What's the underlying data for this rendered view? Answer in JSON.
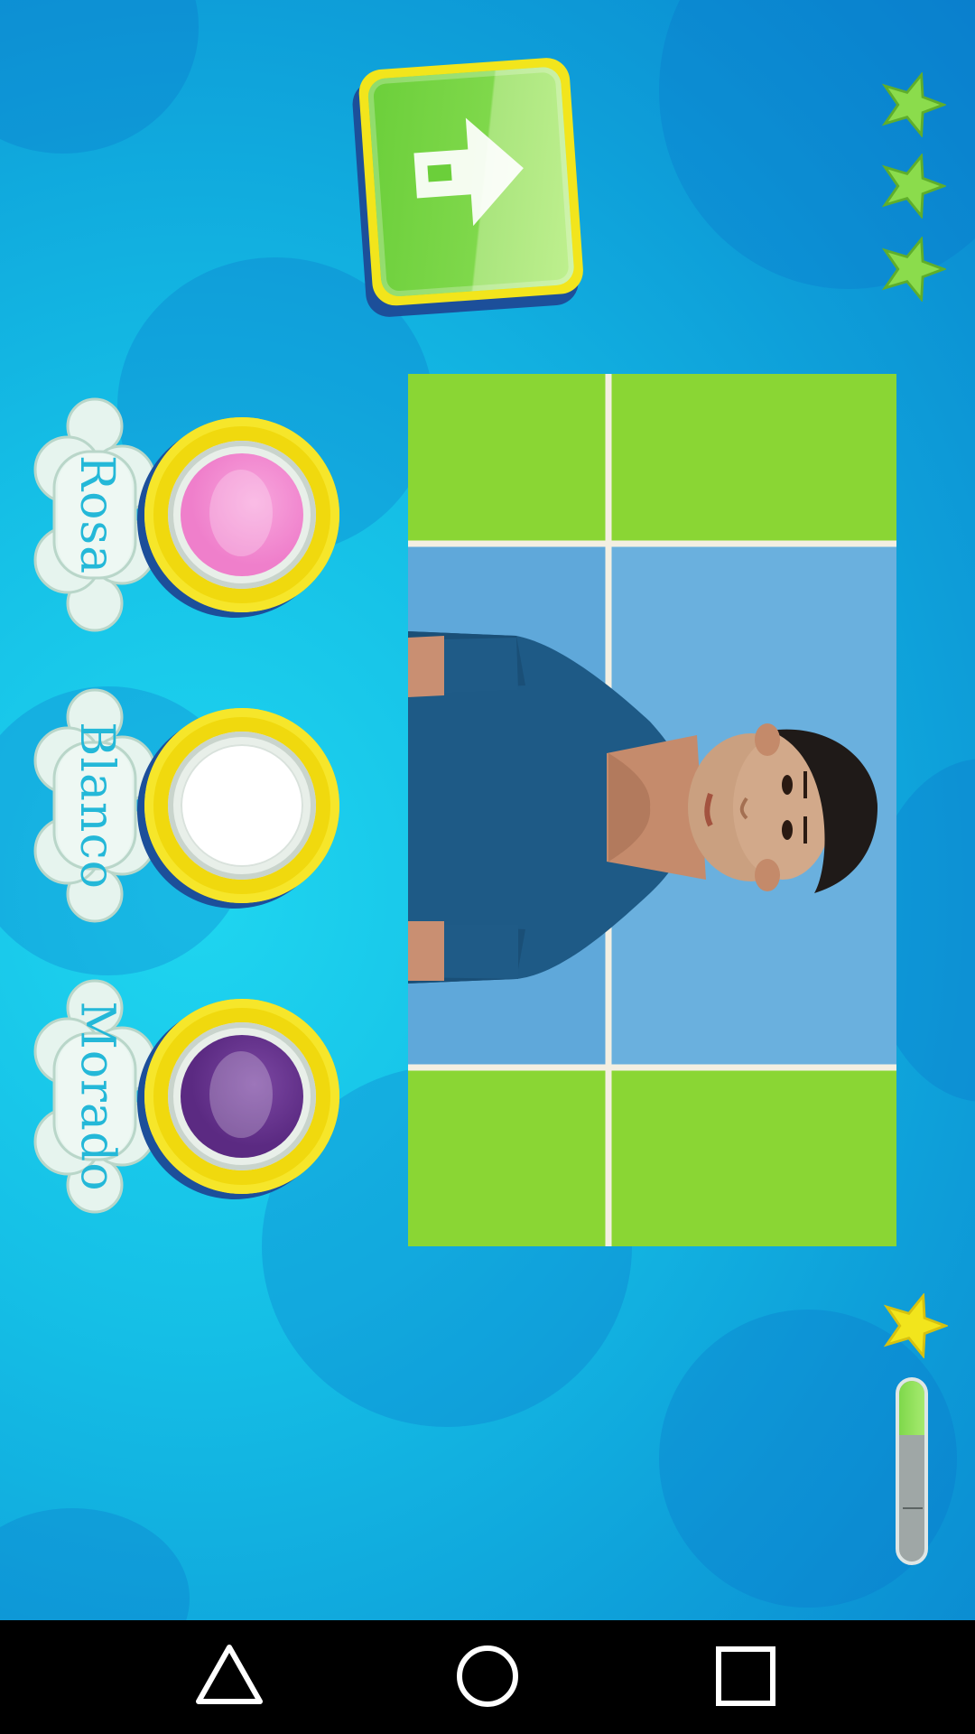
{
  "colors": {
    "bg_mid": "#15bfe6",
    "bg_dark": "#0a86cf",
    "button_green": "#7fd84b",
    "ring_yellow": "#f0d90e",
    "star_green": "#8bdc4c",
    "star_yellow": "#f2e51c"
  },
  "icons": {
    "next_button": "arrow-right-icon",
    "stars": [
      "star-icon",
      "star-icon",
      "star-icon"
    ],
    "progress": "star-icon"
  },
  "score": {
    "stars_total": 3
  },
  "options": [
    {
      "label": "Rosa",
      "color": "#ef7fcb",
      "shine": "#f8a6dd"
    },
    {
      "label": "Blanco",
      "color": "#ffffff",
      "shine": "#ffffff"
    },
    {
      "label": "Morado",
      "color": "#5b2a82",
      "shine": "#7c48a3"
    }
  ],
  "progress": {
    "fraction": 0.3
  },
  "nav": {
    "back": "back-triangle-icon",
    "home": "home-circle-icon",
    "recents": "recents-square-icon"
  }
}
